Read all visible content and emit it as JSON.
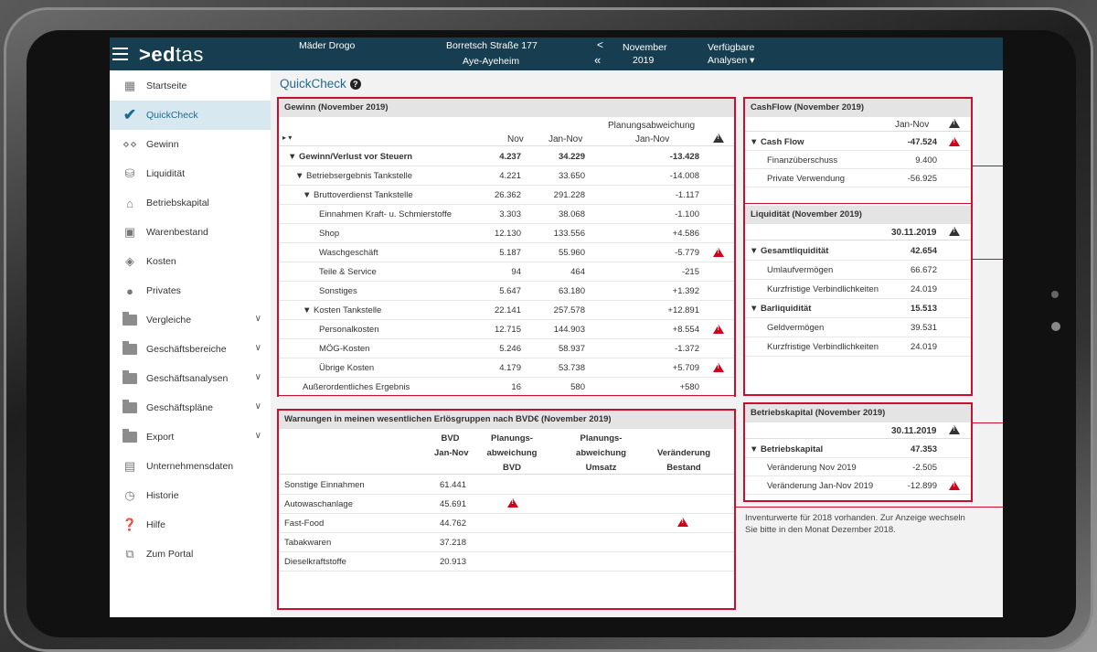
{
  "app": {
    "logo_prefix": ">ed",
    "logo_suffix": "tas"
  },
  "header": {
    "company": "Mäder Drogo",
    "street": "Borretsch Straße 177",
    "city": "Aye-Ayeheim",
    "nav_prev": "<",
    "nav_first": "«",
    "month": "November",
    "year": "2019",
    "analyses": "Verfügbare",
    "analyses2": "Analysen ▾"
  },
  "sidebar": {
    "items": [
      {
        "label": "Startseite",
        "icon": "grid-icon"
      },
      {
        "label": "QuickCheck",
        "icon": "check-icon"
      },
      {
        "label": "Gewinn",
        "icon": "birds-icon"
      },
      {
        "label": "Liquidität",
        "icon": "coins-hand-icon"
      },
      {
        "label": "Betriebskapital",
        "icon": "bank-icon"
      },
      {
        "label": "Warenbestand",
        "icon": "box-icon"
      },
      {
        "label": "Kosten",
        "icon": "tag-icon"
      },
      {
        "label": "Privates",
        "icon": "lock-icon"
      },
      {
        "label": "Vergleiche",
        "icon": "folder-icon"
      },
      {
        "label": "Geschäftsbereiche",
        "icon": "folder-icon"
      },
      {
        "label": "Geschäftsanalysen",
        "icon": "folder-icon"
      },
      {
        "label": "Geschäftspläne",
        "icon": "folder-icon"
      },
      {
        "label": "Export",
        "icon": "folder-icon"
      },
      {
        "label": "Unternehmensdaten",
        "icon": "document-icon"
      },
      {
        "label": "Historie",
        "icon": "history-icon"
      },
      {
        "label": "Hilfe",
        "icon": "help-icon"
      },
      {
        "label": "Zum Portal",
        "icon": "portal-icon"
      }
    ]
  },
  "page": {
    "title": "QuickCheck",
    "help": "?"
  },
  "gewinn": {
    "title": "Gewinn (November 2019)",
    "col_group": "Planungsabweichung",
    "cols": [
      "Nov",
      "Jan-Nov",
      "Jan-Nov"
    ],
    "rows": [
      {
        "label": "▼ Gewinn/Verlust vor Steuern",
        "v1": "4.237",
        "v2": "34.229",
        "v3": "-13.428"
      },
      {
        "label": "▼ Betriebsergebnis Tankstelle",
        "v1": "4.221",
        "v2": "33.650",
        "v3": "-14.008"
      },
      {
        "label": "▼ Bruttoverdienst Tankstelle",
        "v1": "26.362",
        "v2": "291.228",
        "v3": "-1.117"
      },
      {
        "label": "Einnahmen Kraft- u. Schmierstoffe",
        "v1": "3.303",
        "v2": "38.068",
        "v3": "-1.100"
      },
      {
        "label": "Shop",
        "v1": "12.130",
        "v2": "133.556",
        "v3": "+4.586"
      },
      {
        "label": "Waschgeschäft",
        "v1": "5.187",
        "v2": "55.960",
        "v3": "-5.779"
      },
      {
        "label": "Teile & Service",
        "v1": "94",
        "v2": "464",
        "v3": "-215"
      },
      {
        "label": "Sonstiges",
        "v1": "5.647",
        "v2": "63.180",
        "v3": "+1.392"
      },
      {
        "label": "▼ Kosten Tankstelle",
        "v1": "22.141",
        "v2": "257.578",
        "v3": "+12.891"
      },
      {
        "label": "Personalkosten",
        "v1": "12.715",
        "v2": "144.903",
        "v3": "+8.554"
      },
      {
        "label": "MÖG-Kosten",
        "v1": "5.246",
        "v2": "58.937",
        "v3": "-1.372"
      },
      {
        "label": "Übrige Kosten",
        "v1": "4.179",
        "v2": "53.738",
        "v3": "+5.709"
      },
      {
        "label": "Außerordentliches Ergebnis",
        "v1": "16",
        "v2": "580",
        "v3": "+580"
      }
    ]
  },
  "cashflow": {
    "title": "CashFlow (November 2019)",
    "col": "Jan-Nov",
    "rows": [
      {
        "label": "▼ Cash Flow",
        "v": "-47.524"
      },
      {
        "label": "Finanzüberschuss",
        "v": "9.400"
      },
      {
        "label": "Private Verwendung",
        "v": "-56.925"
      }
    ]
  },
  "liquiditaet": {
    "title": "Liquidität (November 2019)",
    "col": "30.11.2019",
    "rows": [
      {
        "label": "▼ Gesamtliquidität",
        "v": "42.654"
      },
      {
        "label": "Umlaufvermögen",
        "v": "66.672"
      },
      {
        "label": "Kurzfristige Verbindlichkeiten",
        "v": "24.019"
      },
      {
        "label": "▼ Barliquidität",
        "v": "15.513"
      },
      {
        "label": "Geldvermögen",
        "v": "39.531"
      },
      {
        "label": "Kurzfristige Verbindlichkeiten",
        "v": "24.019"
      }
    ]
  },
  "betriebskapital": {
    "title": "Betriebskapital (November 2019)",
    "col": "30.11.2019",
    "rows": [
      {
        "label": "▼ Betriebskapital",
        "v": "47.353"
      },
      {
        "label": "Veränderung Nov 2019",
        "v": "-2.505"
      },
      {
        "label": "Veränderung Jan-Nov 2019",
        "v": "-12.899"
      }
    ]
  },
  "note": {
    "line1": "Inventurwerte für 2018 vorhanden. Zur Anzeige wechseln",
    "line2": "Sie bitte in den Monat Dezember 2018."
  },
  "warnungen": {
    "title": "Warnungen in meinen wesentlichen Erlösgruppen nach BVD€ (November 2019)",
    "h1": [
      "BVD",
      "Jan-Nov"
    ],
    "h2": [
      "Planungs-",
      "abweichung",
      "BVD"
    ],
    "h3": [
      "Planungs-",
      "abweichung",
      "Umsatz"
    ],
    "h4": [
      "Veränderung",
      "Bestand"
    ],
    "rows": [
      {
        "label": "Sonstige Einnahmen",
        "v": "61.441"
      },
      {
        "label": "Autowaschanlage",
        "v": "45.691"
      },
      {
        "label": "Fast-Food",
        "v": "44.762"
      },
      {
        "label": "Tabakwaren",
        "v": "37.218"
      },
      {
        "label": "Dieselkraftstoffe",
        "v": "20.913"
      }
    ]
  },
  "colors": {
    "header": "#173e50",
    "accent": "#1f6b8f",
    "alert": "#d0021b",
    "frame": "#c8102e"
  }
}
